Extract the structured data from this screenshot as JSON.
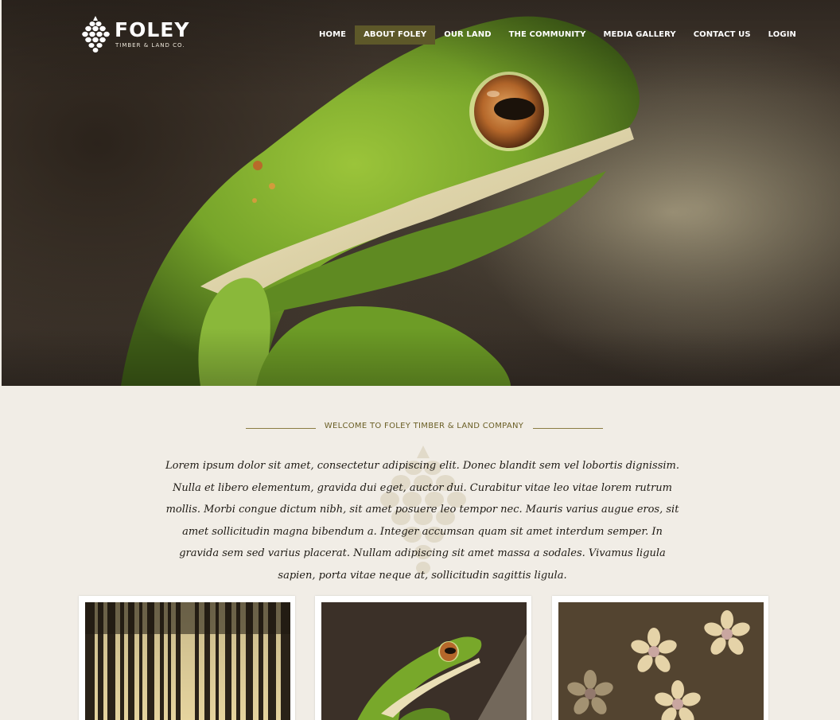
{
  "brand": {
    "name": "FOLEY",
    "tagline": "TIMBER & LAND CO."
  },
  "nav": {
    "items": [
      {
        "label": "HOME"
      },
      {
        "label": "ABOUT FOLEY",
        "active": true
      },
      {
        "label": "OUR LAND"
      },
      {
        "label": "THE COMMUNITY"
      },
      {
        "label": "MEDIA GALLERY"
      },
      {
        "label": "CONTACT US"
      },
      {
        "label": "LOGIN"
      }
    ]
  },
  "hero": {
    "subject": "green tree frog close-up"
  },
  "welcome": {
    "title": "WELCOME TO FOLEY TIMBER & LAND COMPANY",
    "body": "Lorem ipsum dolor sit amet, consectetur adipiscing elit. Donec blandit sem vel lobortis dignissim. Nulla et libero elementum, gravida dui eget, auctor dui. Curabitur vitae leo vitae lorem rutrum mollis. Morbi congue dictum nibh, sit amet posuere leo tempor nec. Mauris varius augue eros, sit amet sollicitudin magna bibendum a. Integer accumsan quam sit amet interdum semper. In gravida sem sed varius placerat. Nullam adipiscing sit amet massa a sodales. Vivamus ligula sapien, porta vitae neque at, sollicitudin sagittis ligula."
  },
  "gallery": [
    {
      "subject": "pine forest trunks"
    },
    {
      "subject": "green tree frog"
    },
    {
      "subject": "milkweed flowers"
    }
  ],
  "colors": {
    "page_background": "#f1ede6",
    "nav_active": "#5d5829",
    "accent_olive": "#6a5e25",
    "frog_green": "#7fae2e"
  },
  "icons": {
    "logo": "pinecone-icon",
    "watermark": "pinecone-watermark-icon"
  }
}
